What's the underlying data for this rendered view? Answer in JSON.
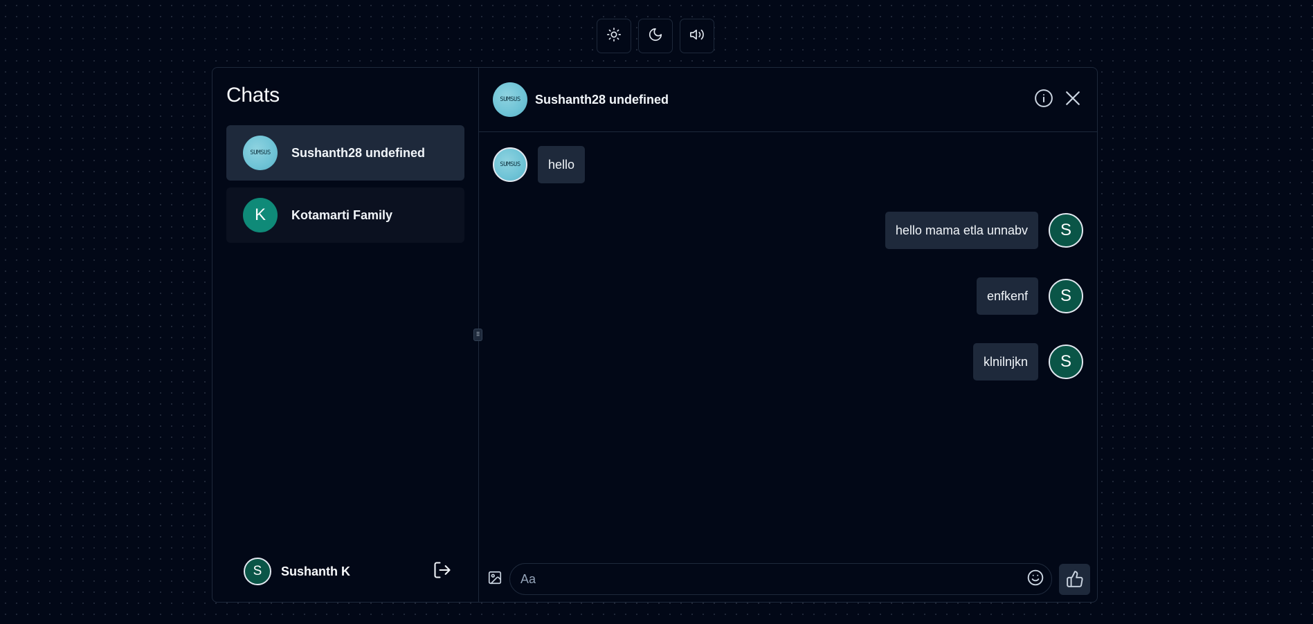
{
  "toolbar": {
    "buttons": [
      {
        "icon": "sun-icon"
      },
      {
        "icon": "moon-icon"
      },
      {
        "icon": "speaker-icon"
      }
    ]
  },
  "sidebar": {
    "title": "Chats",
    "chats": [
      {
        "name": "Sushanth28 undefined",
        "avatar_text": "SUMSUS",
        "active": true
      },
      {
        "name": "Kotamarti Family",
        "avatar_letter": "K",
        "active": false
      }
    ],
    "current_user": {
      "initial": "S",
      "name": "Sushanth K"
    }
  },
  "chat": {
    "header": {
      "name": "Sushanth28 undefined",
      "avatar_text": "SUMSUS"
    },
    "messages": [
      {
        "direction": "in",
        "text": "hello",
        "avatar_text": "SUMSUS"
      },
      {
        "direction": "out",
        "text": "hello mama etla unnabv",
        "avatar_initial": "S"
      },
      {
        "direction": "out",
        "text": "enfkenf",
        "avatar_initial": "S"
      },
      {
        "direction": "out",
        "text": "klnilnjkn",
        "avatar_initial": "S"
      }
    ],
    "composer": {
      "placeholder": "Aa",
      "value": ""
    }
  },
  "colors": {
    "background": "#020817",
    "panel_border": "#1e293b",
    "bubble": "#1e293b",
    "avatar_green": "#0f8a78",
    "avatar_dark_green": "#0a5547"
  }
}
